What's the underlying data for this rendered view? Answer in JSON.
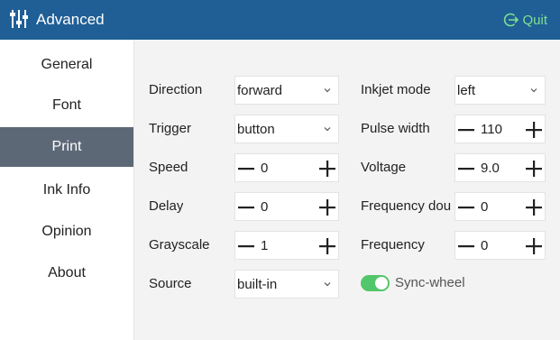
{
  "window": {
    "title": "Advanced",
    "quit_label": "Quit"
  },
  "colors": {
    "titlebar": "#1f5f96",
    "active_nav": "#5d6877",
    "quit_accent": "#7fe08f",
    "toggle_on": "#52c66a",
    "content_bg": "#f3f3f3"
  },
  "sidebar": {
    "items": [
      {
        "label": "General"
      },
      {
        "label": "Font"
      },
      {
        "label": "Print",
        "active": true
      },
      {
        "label": "Ink Info"
      },
      {
        "label": "Opinion"
      },
      {
        "label": "About"
      }
    ]
  },
  "settings": {
    "direction": {
      "label": "Direction",
      "value": "forward"
    },
    "trigger": {
      "label": "Trigger",
      "value": "button"
    },
    "speed": {
      "label": "Speed",
      "value": "0"
    },
    "delay": {
      "label": "Delay",
      "value": "0"
    },
    "grayscale": {
      "label": "Grayscale",
      "value": "1"
    },
    "source": {
      "label": "Source",
      "value": "built-in"
    },
    "inkjet_mode": {
      "label": "Inkjet mode",
      "value": "left"
    },
    "pulse_width": {
      "label": "Pulse width",
      "value": "110"
    },
    "voltage": {
      "label": "Voltage",
      "value": "9.0"
    },
    "frequency_doubling": {
      "label": "Frequency dou",
      "value": "0"
    },
    "frequency": {
      "label": "Frequency",
      "value": "0"
    },
    "sync_wheel": {
      "label": "Sync-wheel",
      "enabled": true
    }
  }
}
